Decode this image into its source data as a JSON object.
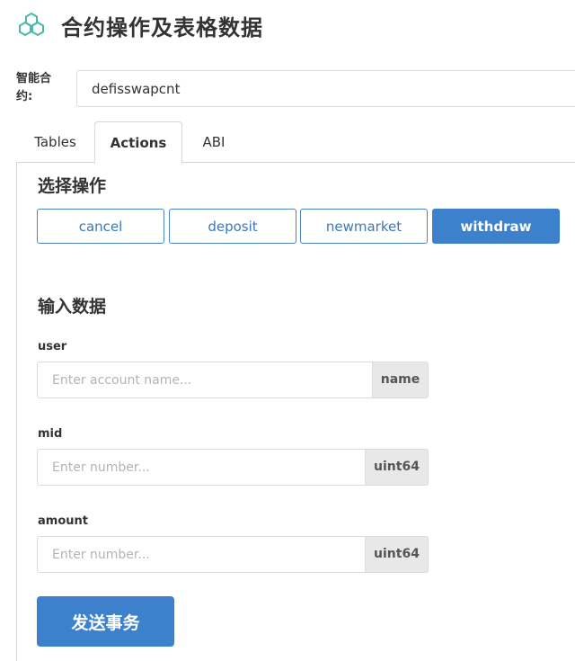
{
  "header": {
    "logo_icon": "hexagon-cluster-icon",
    "title": "合约操作及表格数据"
  },
  "contract": {
    "label": "智能合约:",
    "value": "defisswapcnt"
  },
  "tabs": [
    {
      "label": "Tables",
      "active": false
    },
    {
      "label": "Actions",
      "active": true
    },
    {
      "label": "ABI",
      "active": false
    }
  ],
  "actions_section": {
    "title": "选择操作",
    "buttons": [
      {
        "label": "cancel",
        "active": false
      },
      {
        "label": "deposit",
        "active": false
      },
      {
        "label": "newmarket",
        "active": false
      },
      {
        "label": "withdraw",
        "active": true
      }
    ]
  },
  "input_section": {
    "title": "输入数据",
    "fields": [
      {
        "label": "user",
        "placeholder": "Enter account name...",
        "type": "name"
      },
      {
        "label": "mid",
        "placeholder": "Enter number...",
        "type": "uint64"
      },
      {
        "label": "amount",
        "placeholder": "Enter number...",
        "type": "uint64"
      }
    ]
  },
  "submit_label": "发送事务",
  "colors": {
    "accent": "#3d80cc",
    "border": "#dcdcdc",
    "addon_bg": "#e8e8e8",
    "logo": "#4db6ac"
  }
}
